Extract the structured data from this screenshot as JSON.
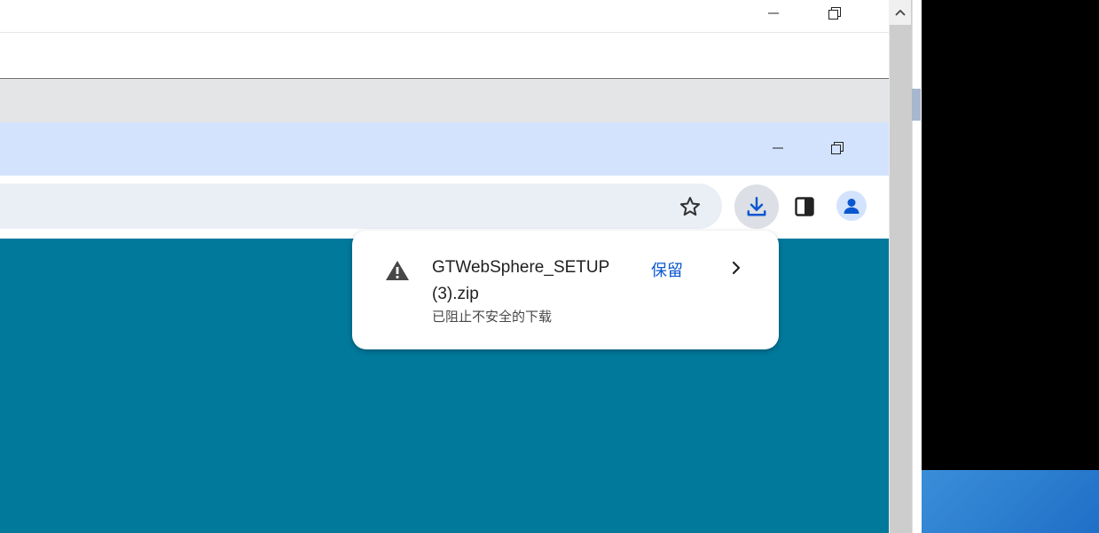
{
  "download_popup": {
    "file_name": "GTWebSphere_SETUP (3).zip",
    "status": "已阻止不安全的下载",
    "keep_label": "保留"
  },
  "icons": {
    "minimize": "minimize-icon",
    "restore": "restore-icon",
    "bookmark": "star-icon",
    "downloads": "download-icon",
    "side_panel": "side-panel-icon",
    "profile": "profile-icon",
    "warning": "warning-icon",
    "expand": "chevron-right-icon",
    "scroll_up": "scroll-up-icon"
  },
  "colors": {
    "page_background": "#00799b",
    "chrome_title": "#d3e3fd",
    "accent": "#0b57d0",
    "warning": "#474747"
  }
}
